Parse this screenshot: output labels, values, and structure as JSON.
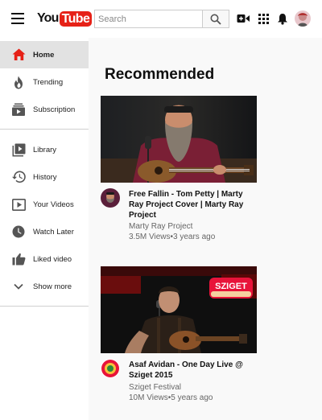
{
  "header": {
    "logo_you": "You",
    "logo_tube": "Tube",
    "search_placeholder": "Search"
  },
  "sidebar": {
    "items": [
      {
        "label": "Home",
        "icon": "home-icon",
        "active": true
      },
      {
        "label": "Trending",
        "icon": "flame-icon"
      },
      {
        "label": "Subscription",
        "icon": "subscriptions-icon"
      },
      {
        "label": "Library",
        "icon": "library-icon"
      },
      {
        "label": "History",
        "icon": "history-icon"
      },
      {
        "label": "Your Videos",
        "icon": "play-box-icon"
      },
      {
        "label": "Watch Later",
        "icon": "clock-icon"
      },
      {
        "label": "Liked video",
        "icon": "thumbs-up-icon"
      },
      {
        "label": "Show more",
        "icon": "chevron-down-icon"
      }
    ]
  },
  "main": {
    "section_title": "Recommended",
    "videos": [
      {
        "title": "Free Fallin - Tom Petty | Marty Ray Project Cover | Marty Ray Project",
        "channel": "Marty Ray Project",
        "meta": "3.5M Views•3 years ago"
      },
      {
        "title": "Asaf Avidan - One Day Live @ Sziget 2015",
        "channel": "Sziget Festival",
        "meta": "10M Views•5 years ago",
        "overlay_badge": "SZIGET"
      }
    ]
  },
  "colors": {
    "brand_red": "#e62117",
    "active_nav": "#e2e2e2",
    "background": "#f9f9f9"
  }
}
